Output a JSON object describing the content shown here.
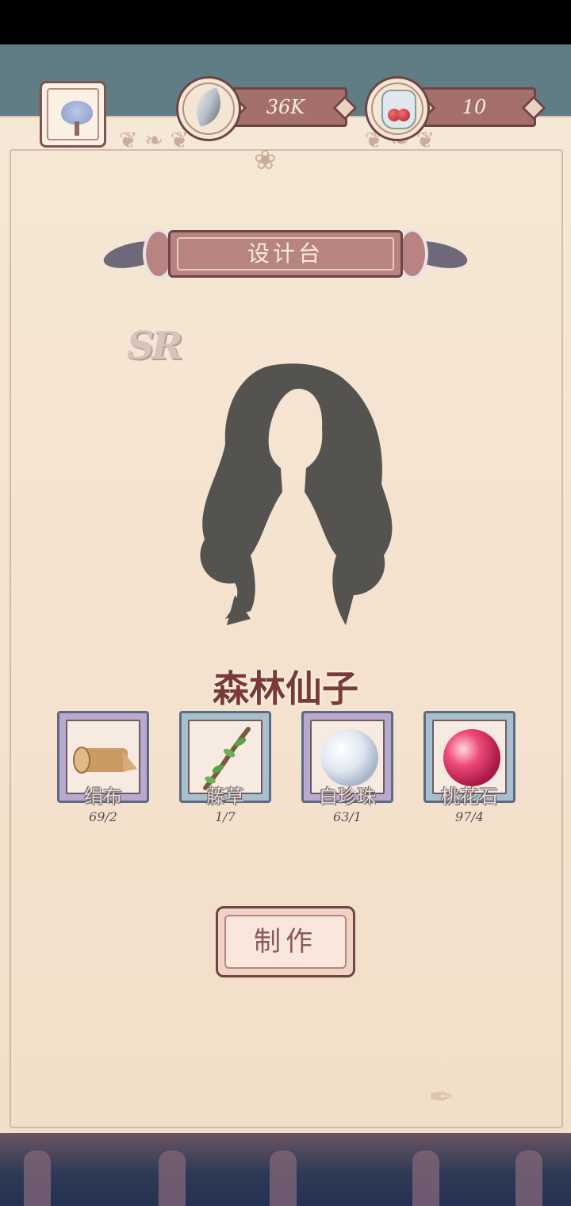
{
  "resources": {
    "feathers": {
      "value": "36K",
      "icon": "feather-icon"
    },
    "berries": {
      "value": "10",
      "icon": "berry-jar-icon"
    }
  },
  "header": {
    "title": "设计台"
  },
  "design": {
    "rarity": "SR",
    "name": "森林仙子"
  },
  "materials": [
    {
      "name": "绢布",
      "count": "69/2",
      "icon": "silk-cloth-icon"
    },
    {
      "name": "藤草",
      "count": "1/7",
      "icon": "vine-icon"
    },
    {
      "name": "白珍珠",
      "count": "63/1",
      "icon": "white-pearl-icon"
    },
    {
      "name": "桃花石",
      "count": "97/4",
      "icon": "peach-blossom-stone-icon"
    }
  ],
  "actions": {
    "make_label": "制作"
  }
}
